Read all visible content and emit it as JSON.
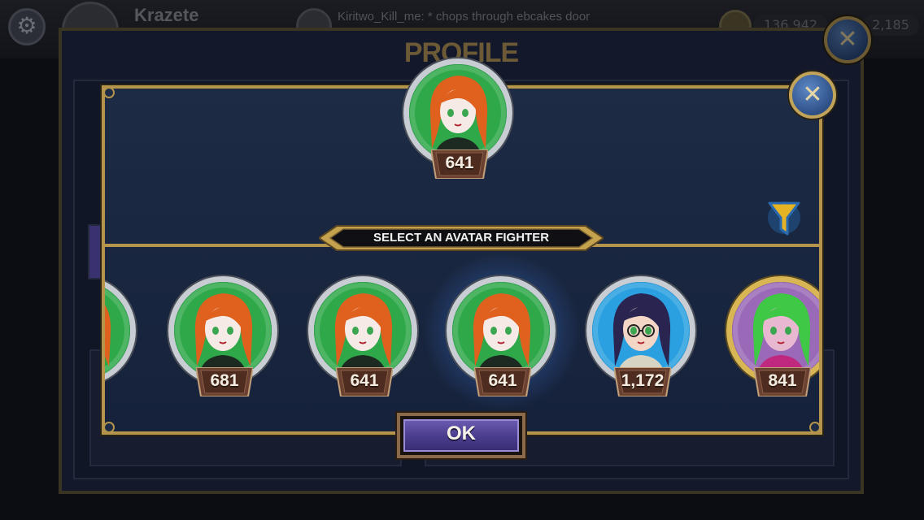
{
  "hud": {
    "player_name": "Krazete",
    "chat_line": "Kiritwo_Kill_me: * chops through ebcakes door",
    "currency_1": "136,942",
    "currency_2": "2,185"
  },
  "profile": {
    "title": "PROFILE"
  },
  "modal": {
    "current_avatar": {
      "level": "641",
      "bg": "#2fa84a",
      "hair": "#e0601e",
      "skin": "#f6eae6",
      "outfit": "#1d2a22"
    },
    "banner_label": "SELECT AN AVATAR FIGHTER",
    "ok_label": "OK",
    "avatars": [
      {
        "level": "",
        "bg": "#2fa84a",
        "hair": "#e0601e",
        "skin": "#f6eae6",
        "outfit": "#1d2a22",
        "selected": false,
        "gold": false
      },
      {
        "level": "681",
        "bg": "#2fa84a",
        "hair": "#e0601e",
        "skin": "#f6eae6",
        "outfit": "#1d2a22",
        "selected": false,
        "gold": false
      },
      {
        "level": "641",
        "bg": "#2fa84a",
        "hair": "#e0601e",
        "skin": "#f6eae6",
        "outfit": "#1d2a22",
        "selected": false,
        "gold": false
      },
      {
        "level": "641",
        "bg": "#2fa84a",
        "hair": "#e0601e",
        "skin": "#f6eae6",
        "outfit": "#1d2a22",
        "selected": true,
        "gold": false
      },
      {
        "level": "1,172",
        "bg": "#2aa0e0",
        "hair": "#2a2550",
        "skin": "#f4d6c6",
        "outfit": "#d8d4c4",
        "selected": false,
        "gold": false,
        "glasses": true
      },
      {
        "level": "841",
        "bg": "#9a6ab8",
        "hair": "#3ec846",
        "skin": "#e8b8d0",
        "outfit": "#c02880",
        "selected": false,
        "gold": true
      }
    ]
  },
  "colors": {
    "gold_trim": "#b5944b",
    "panel": "#1a2740",
    "ok_button": "#4a3c8c",
    "plate": "#5a3a2a"
  },
  "icons": {
    "close": "close-icon",
    "filter": "filter-icon",
    "settings": "gear-icon"
  }
}
